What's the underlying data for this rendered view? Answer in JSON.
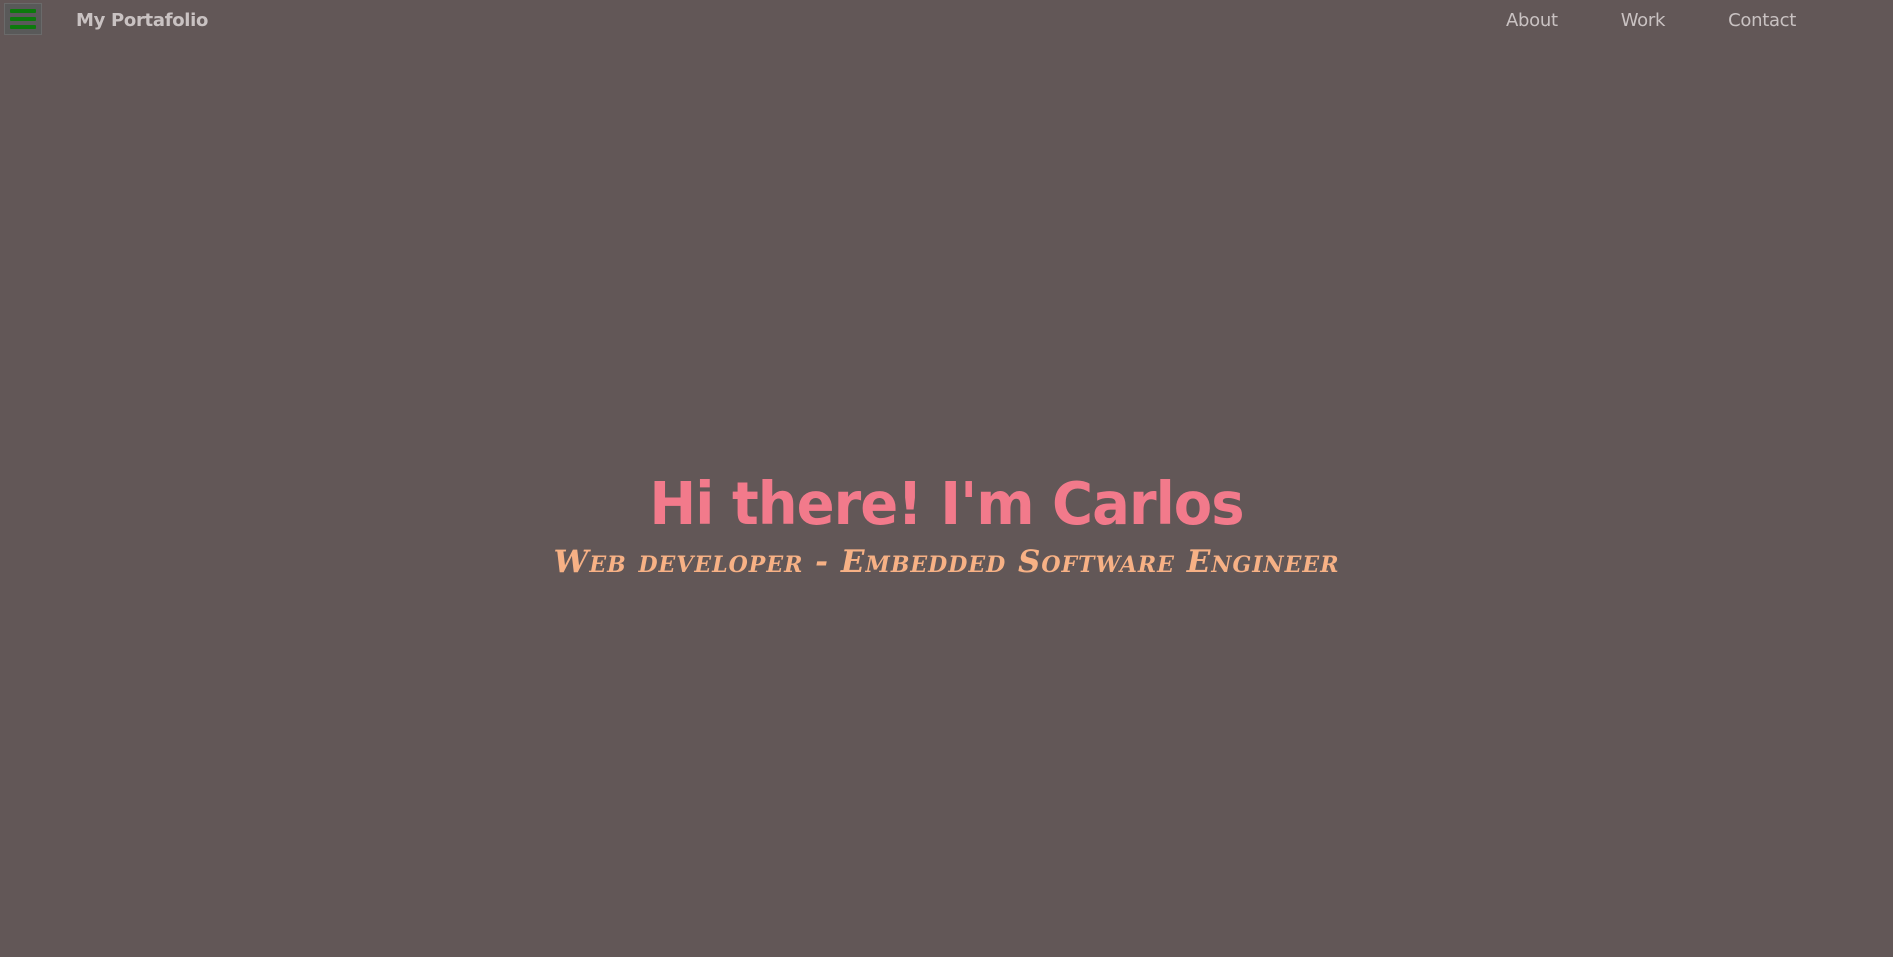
{
  "navbar": {
    "menu_icon": "hamburger-menu-icon",
    "brand": "My Portafolio",
    "links": [
      {
        "label": "About"
      },
      {
        "label": "Work"
      },
      {
        "label": "Contact"
      }
    ]
  },
  "hero": {
    "title": "Hi there! I'm Carlos",
    "subtitle": "Web developer - Embedded Software Engineer"
  },
  "colors": {
    "background": "#625757",
    "title": "#f27a8b",
    "subtitle": "#f7b185",
    "nav_text": "#c9c2c2",
    "menu_icon": "#0c7a0c"
  }
}
